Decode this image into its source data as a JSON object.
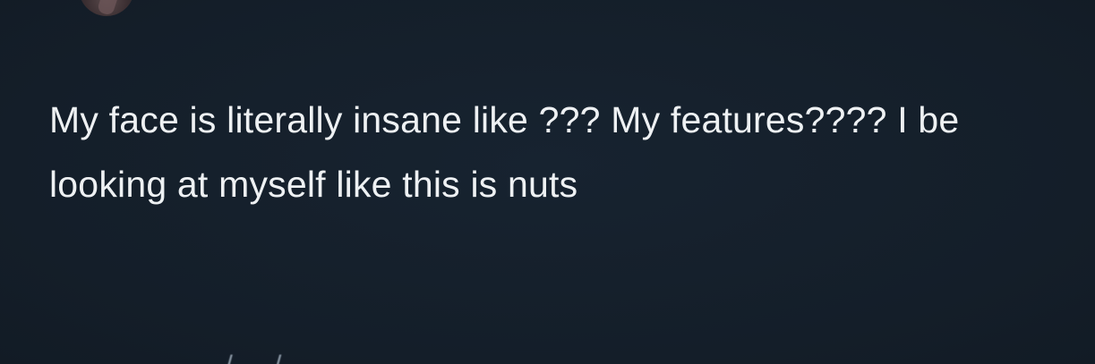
{
  "tweet": {
    "text": "My face is literally insane like ??? My features???? I be looking at myself like this is nuts"
  },
  "colors": {
    "background": "#15202b",
    "text": "#eef1f3",
    "muted": "#8b98a5"
  }
}
